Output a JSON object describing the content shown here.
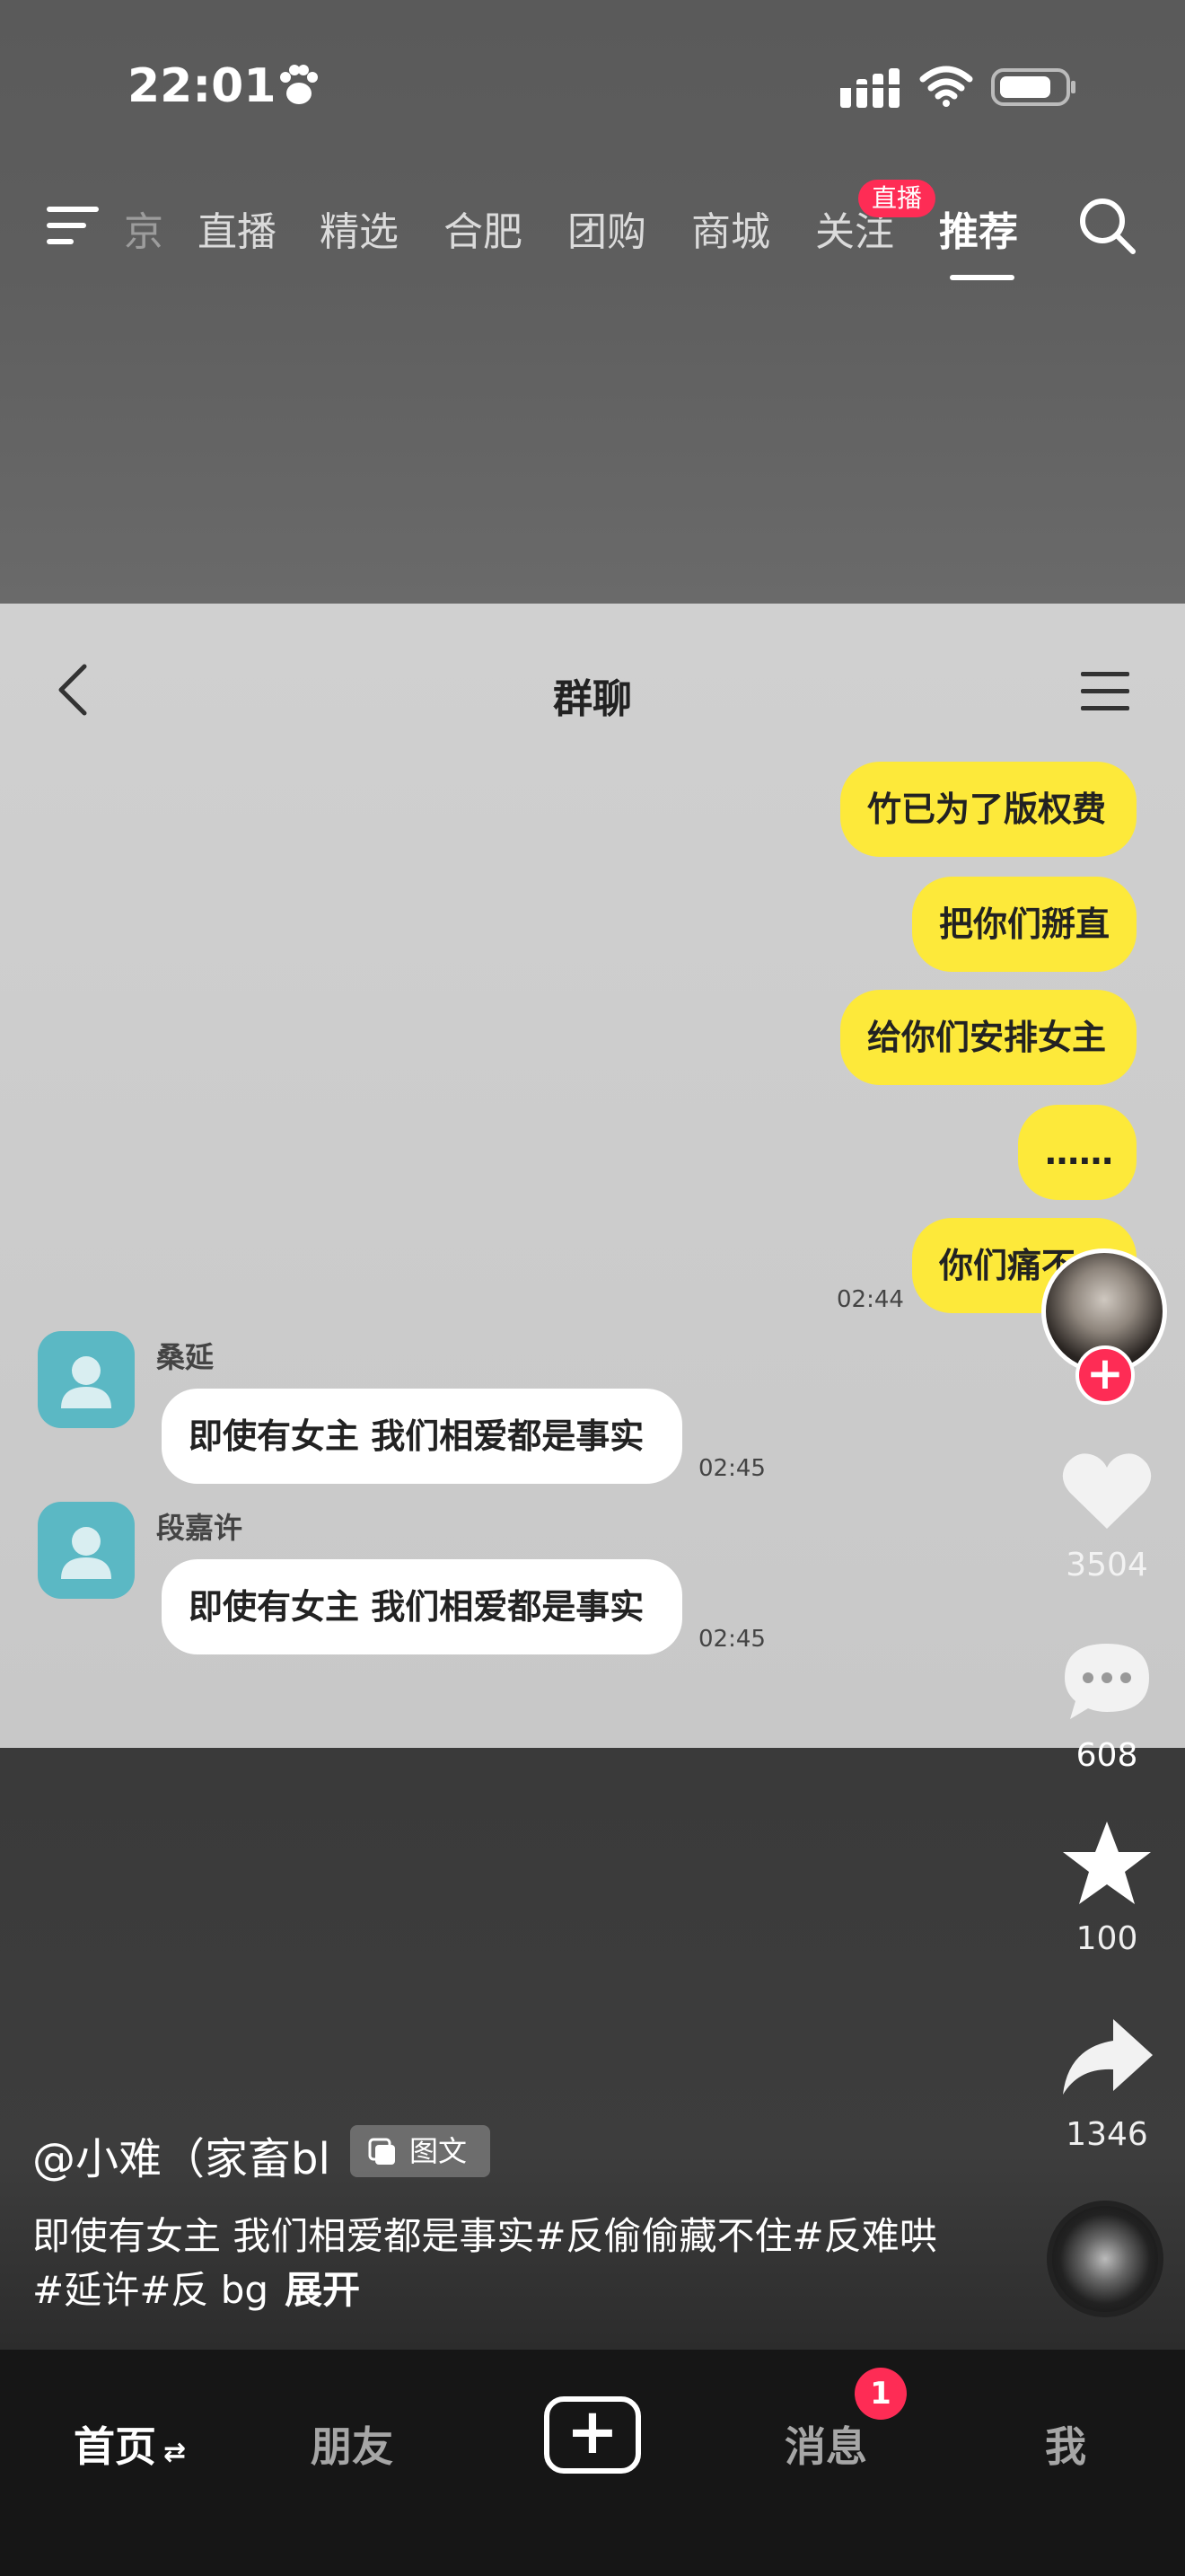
{
  "status_bar": {
    "time": "22:01"
  },
  "top_tabs": {
    "tabs": [
      "京",
      "直播",
      "精选",
      "合肥",
      "团购",
      "商城",
      "关注",
      "推荐"
    ],
    "live_badge": "直播",
    "active": "推荐"
  },
  "chat": {
    "title": "群聊",
    "my_messages": [
      "竹已为了版权费",
      "把你们掰直",
      "给你们安排女主",
      "……",
      "你们痛不"
    ],
    "my_time": "02:44",
    "others": [
      {
        "sender": "桑延",
        "text": "即使有女主  我们相爱都是事实",
        "time": "02:45"
      },
      {
        "sender": "段嘉许",
        "text": "即使有女主  我们相爱都是事实",
        "time": "02:45"
      }
    ]
  },
  "actions": {
    "likes": "3504",
    "comments": "608",
    "favorites": "100",
    "shares": "1346"
  },
  "post": {
    "author": "@小难（家畜bl",
    "type_label": "图文",
    "caption": "即使有女主 我们相爱都是事实#反偷偷藏不住#反难哄#延许#反 bg",
    "expand": "展开"
  },
  "bottom_nav": {
    "home": "首页",
    "friends": "朋友",
    "messages": "消息",
    "messages_badge": "1",
    "me": "我"
  },
  "colors": {
    "accent": "#fe2c55",
    "chat_bubble_me": "#fde93a",
    "chat_avatar": "#5bb8c4"
  }
}
